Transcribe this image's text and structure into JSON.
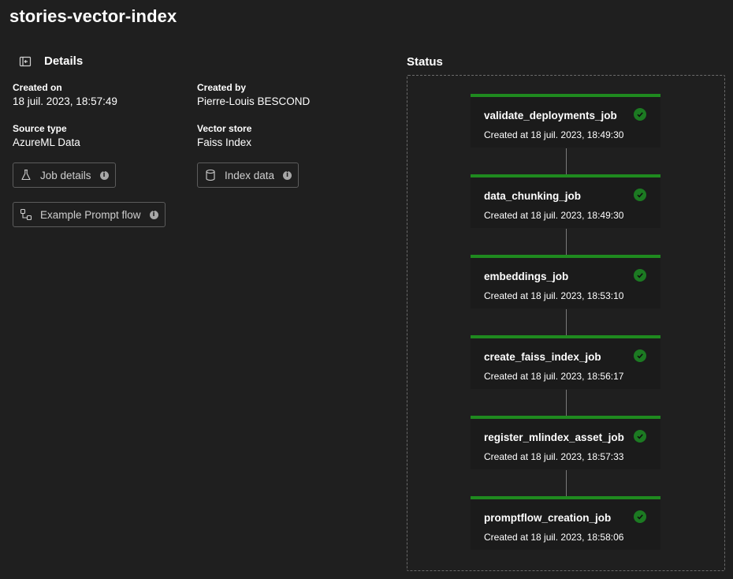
{
  "page": {
    "title": "stories-vector-index"
  },
  "details": {
    "title": "Details",
    "created_on": {
      "label": "Created on",
      "value": "18 juil. 2023, 18:57:49"
    },
    "created_by": {
      "label": "Created by",
      "value": "Pierre-Louis BESCOND"
    },
    "source_type": {
      "label": "Source type",
      "value": "AzureML Data"
    },
    "vector_store": {
      "label": "Vector store",
      "value": "Faiss Index"
    },
    "buttons": {
      "job_details": "Job details",
      "index_data": "Index data",
      "example_prompt_flow": "Example Prompt flow"
    }
  },
  "status": {
    "title": "Status",
    "jobs": [
      {
        "name": "validate_deployments_job",
        "created": "Created at 18 juil. 2023, 18:49:30",
        "state": "succeeded"
      },
      {
        "name": "data_chunking_job",
        "created": "Created at 18 juil. 2023, 18:49:30",
        "state": "succeeded"
      },
      {
        "name": "embeddings_job",
        "created": "Created at 18 juil. 2023, 18:53:10",
        "state": "succeeded"
      },
      {
        "name": "create_faiss_index_job",
        "created": "Created at 18 juil. 2023, 18:56:17",
        "state": "succeeded"
      },
      {
        "name": "register_mlindex_asset_job",
        "created": "Created at 18 juil. 2023, 18:57:33",
        "state": "succeeded"
      },
      {
        "name": "promptflow_creation_job",
        "created": "Created at 18 juil. 2023, 18:58:06",
        "state": "succeeded"
      }
    ]
  },
  "colors": {
    "background": "#1f1f1f",
    "success": "#1f8a1f",
    "border": "#5c5c5c"
  },
  "icons": {
    "collapse": "collapse-panel-icon",
    "job_details": "flask-icon",
    "index_data": "database-icon",
    "prompt_flow": "flow-icon",
    "info": "info-icon",
    "check": "check-circle-icon"
  }
}
